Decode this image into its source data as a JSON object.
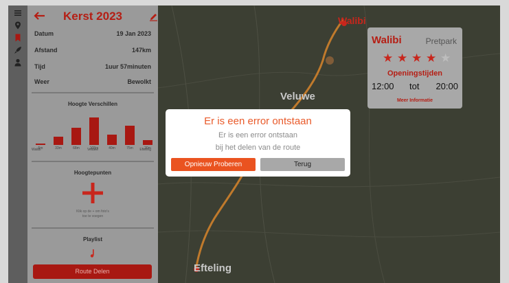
{
  "trip": {
    "title": "Kerst 2023",
    "details": [
      {
        "label": "Datum",
        "value": "19 Jan 2023"
      },
      {
        "label": "Afstand",
        "value": "147km"
      },
      {
        "label": "Tijd",
        "value": "1uur 57minuten"
      },
      {
        "label": "Weer",
        "value": "Bewolkt"
      }
    ]
  },
  "elevation": {
    "title": "Hoogte Verschillen",
    "bars": [
      {
        "height": 5,
        "label": "5m"
      },
      {
        "height": 33,
        "label": "33m"
      },
      {
        "height": 68,
        "label": "68m"
      },
      {
        "height": 108,
        "label": "108m"
      },
      {
        "height": 40,
        "label": "40m"
      },
      {
        "height": 75,
        "label": "75m"
      },
      {
        "height": 20,
        "label": "20m"
      }
    ],
    "start_label": "Walibi",
    "mid_label": "Veluwe",
    "end_label": "Efteling"
  },
  "highlights": {
    "title": "Hoogtepunten",
    "hint_line1": "Klik op de + om foto's",
    "hint_line2": "toe te voegen"
  },
  "playlist": {
    "title": "Playlist"
  },
  "share_button": "Route Delen",
  "map": {
    "labels": {
      "walibi": "Walibi",
      "veluwe": "Veluwe",
      "efteling": "Efteling"
    }
  },
  "poi_card": {
    "name": "Walibi",
    "type": "Pretpark",
    "rating": 4,
    "max_rating": 5,
    "hours_title": "Openingstijden",
    "open": "12:00",
    "sep": "tot",
    "close": "20:00",
    "more": "Meer Informatie"
  },
  "dialog": {
    "title": "Er is een error ontstaan",
    "message_line1": "Er is een error ontstaan",
    "message_line2": "bij het delen van de route",
    "retry_label": "Opnieuw Proberen",
    "back_label": "Terug"
  },
  "colors": {
    "accent": "#ea5320",
    "brand_red": "#c8261c"
  }
}
